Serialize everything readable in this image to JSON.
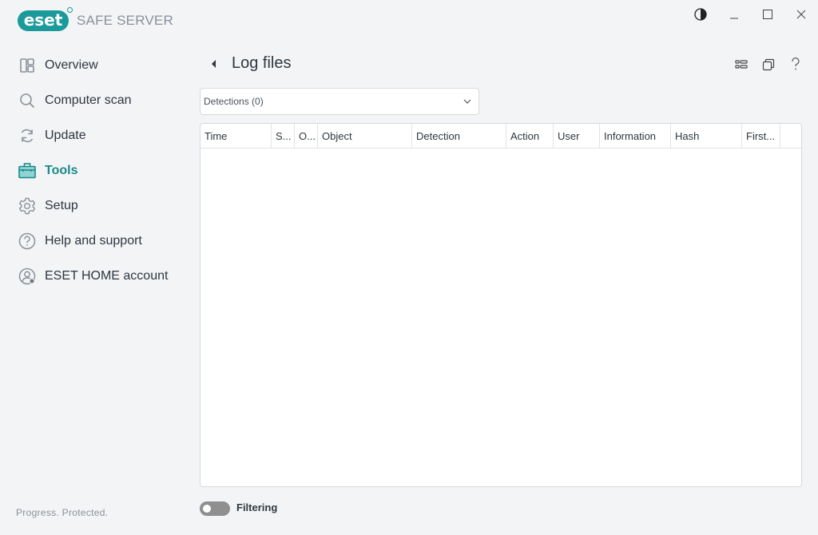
{
  "app": {
    "brand": "eset",
    "product": "SAFE SERVER",
    "tagline": "Progress. Protected.",
    "accent_color": "#1a9a9a"
  },
  "window_controls": {
    "theme_icon": "contrast-icon",
    "minimize_icon": "minimize-icon",
    "maximize_icon": "maximize-icon",
    "close_icon": "close-icon"
  },
  "sidebar": {
    "items": [
      {
        "label": "Overview",
        "icon": "overview-icon",
        "active": false
      },
      {
        "label": "Computer scan",
        "icon": "search-icon",
        "active": false
      },
      {
        "label": "Update",
        "icon": "refresh-icon",
        "active": false
      },
      {
        "label": "Tools",
        "icon": "toolbox-icon",
        "active": true
      },
      {
        "label": "Setup",
        "icon": "gear-icon",
        "active": false
      },
      {
        "label": "Help and support",
        "icon": "help-icon",
        "active": false
      },
      {
        "label": "ESET HOME account",
        "icon": "account-icon",
        "active": false
      }
    ]
  },
  "header": {
    "title": "Log files",
    "back_icon": "back-arrow-icon",
    "actions": [
      "view-layout-icon",
      "copy-icon",
      "help-icon"
    ]
  },
  "log_select": {
    "selected": "Detections (0)"
  },
  "table": {
    "columns": [
      "Time",
      "S...",
      "O...",
      "Object",
      "Detection",
      "Action",
      "User",
      "Information",
      "Hash",
      "First..."
    ],
    "rows": []
  },
  "filter": {
    "label": "Filtering",
    "enabled": false
  }
}
